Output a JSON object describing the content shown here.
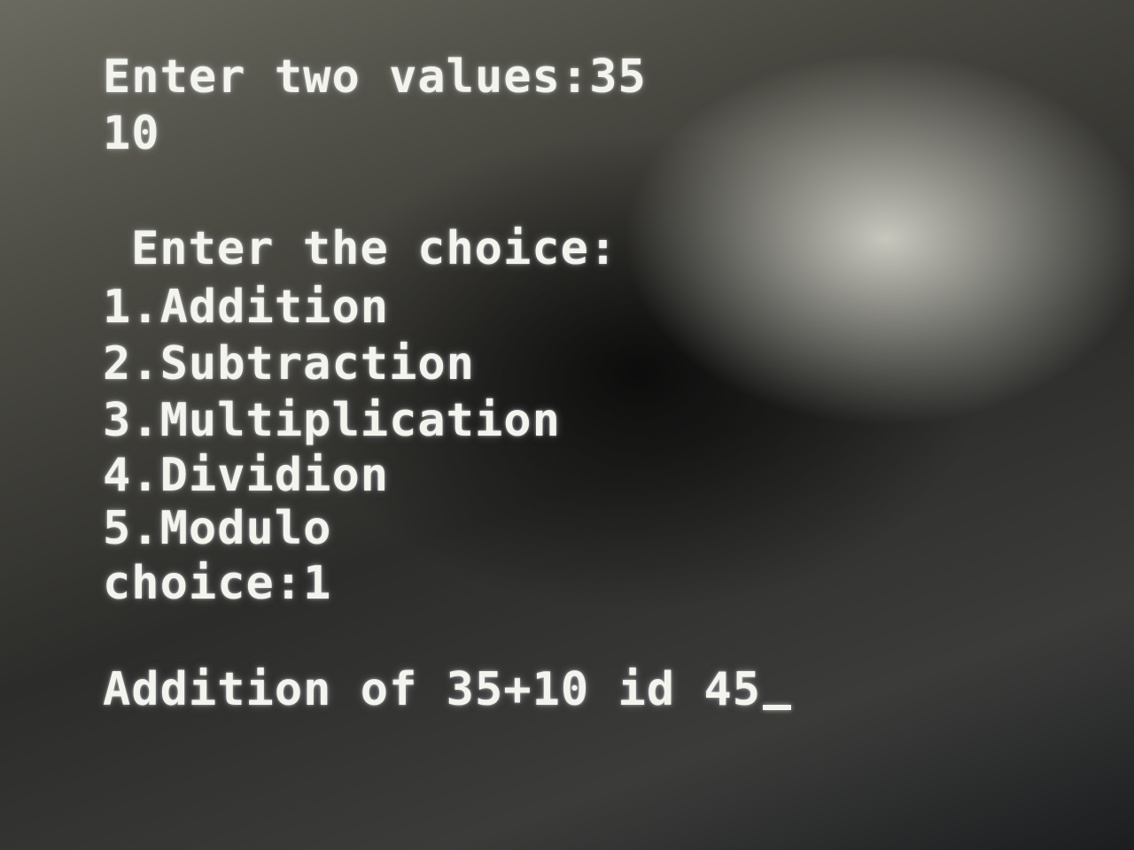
{
  "terminal": {
    "lines": [
      "Enter two values:35",
      "10",
      "Enter the choice:",
      "1.Addition",
      "2.Subtraction",
      "3.Multiplication",
      "4.Dividion",
      "5.Modulo",
      "choice:1",
      "Addition of 35+10 id 45"
    ],
    "colors": {
      "text": "#f4f4ee",
      "background": "#2c2c2a"
    }
  }
}
